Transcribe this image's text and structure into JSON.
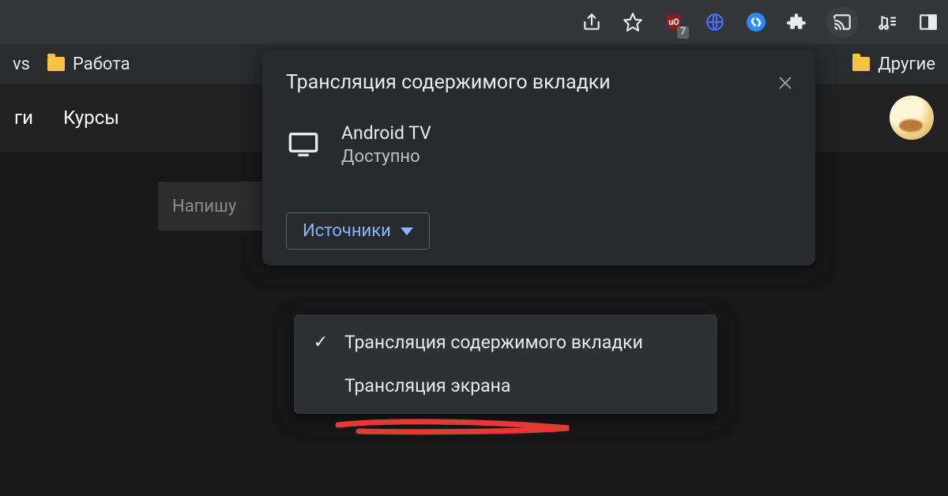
{
  "toolbar": {
    "ublock_badge": "7"
  },
  "bookmarks": {
    "left_partial": "vs",
    "folder1": "Работа",
    "right_folder": "Другие"
  },
  "page_nav": {
    "item1_partial": "ги",
    "item2": "Курсы"
  },
  "compose": {
    "placeholder_partial": "Напишу"
  },
  "cast": {
    "title": "Трансляция содержимого вкладки",
    "device_name": "Android TV",
    "device_status": "Доступно",
    "sources_label": "Источники"
  },
  "sources_menu": {
    "item1": "Трансляция содержимого вкладки",
    "item2": "Трансляция экрана"
  }
}
